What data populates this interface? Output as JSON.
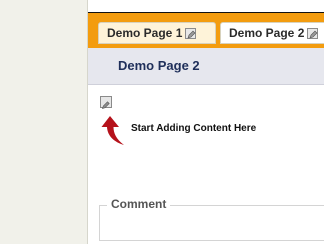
{
  "tabs": [
    {
      "label": "Demo Page 1",
      "state": "active"
    },
    {
      "label": "Demo Page 2",
      "state": "inactive"
    }
  ],
  "page": {
    "title": "Demo Page 2"
  },
  "content": {
    "start_text": "Start Adding Content Here",
    "comment_label": "Comment"
  },
  "colors": {
    "tabbar_bg": "#f39c0f",
    "header_bg": "#e6e7ee",
    "arrow_red": "#b5121b",
    "title_color": "#1f2f5a"
  }
}
